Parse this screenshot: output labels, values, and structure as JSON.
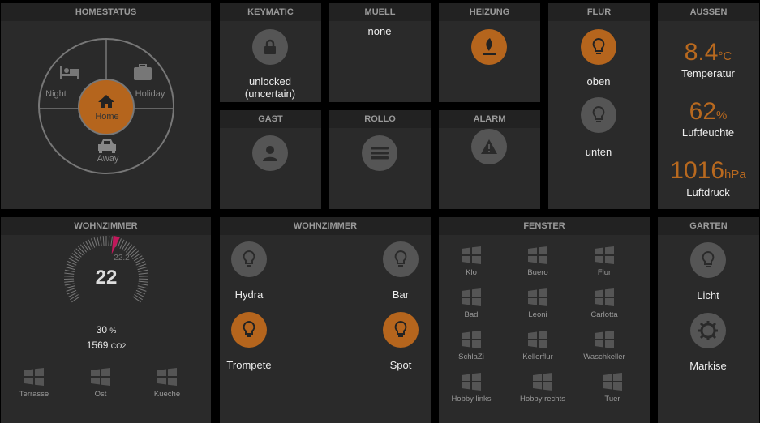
{
  "colors": {
    "accent": "#b5651d",
    "gauge_needle": "#c2185b",
    "icon_off": "#555555"
  },
  "homestatus": {
    "title": "HOMESTATUS",
    "modes": {
      "night": "Night",
      "holiday": "Holiday",
      "home": "Home",
      "away": "Away"
    },
    "active": "Home"
  },
  "keymatic": {
    "title": "KEYMATIC",
    "status_line1": "unlocked",
    "status_line2": "(uncertain)",
    "icon": "lock-icon"
  },
  "muell": {
    "title": "MUELL",
    "value": "none"
  },
  "heizung": {
    "title": "HEIZUNG",
    "icon": "flame-icon",
    "active": true
  },
  "flur": {
    "title": "FLUR",
    "lights": [
      {
        "label": "oben",
        "on": true
      },
      {
        "label": "unten",
        "on": false
      }
    ]
  },
  "aussen": {
    "title": "AUSSEN",
    "temp": {
      "value": "8.4",
      "unit": "°C",
      "label": "Temperatur"
    },
    "humidity": {
      "value": "62",
      "unit": "%",
      "label": "Luftfeuchte"
    },
    "pressure": {
      "value": "1016",
      "unit": "hPa",
      "label": "Luftdruck"
    }
  },
  "gast": {
    "title": "GAST",
    "icon": "user-icon"
  },
  "rollo": {
    "title": "ROLLO",
    "icon": "menu-icon"
  },
  "alarm": {
    "title": "ALARM",
    "icon": "warning-icon"
  },
  "wohnzimmer_climate": {
    "title": "WOHNZIMMER",
    "temp": "22",
    "setpoint": "22.2",
    "humidity": "30",
    "humidity_unit": "%",
    "co2": "1569",
    "co2_unit": "CO2",
    "windows": [
      "Terrasse",
      "Ost",
      "Kueche"
    ]
  },
  "wohnzimmer_lights": {
    "title": "WOHNZIMMER",
    "lights": [
      {
        "label": "Hydra",
        "on": false
      },
      {
        "label": "Bar",
        "on": false
      },
      {
        "label": "Trompete",
        "on": true
      },
      {
        "label": "Spot",
        "on": true
      }
    ]
  },
  "fenster": {
    "title": "FENSTER",
    "windows": [
      "Klo",
      "Buero",
      "Flur",
      "Bad",
      "Leoni",
      "Carlotta",
      "SchlaZi",
      "Kellerflur",
      "Waschkeller",
      "Hobby links",
      "Hobby rechts",
      "Tuer"
    ]
  },
  "garten": {
    "title": "GARTEN",
    "items": [
      {
        "label": "Licht",
        "icon": "bulb-icon"
      },
      {
        "label": "Markise",
        "icon": "sun-icon"
      }
    ]
  }
}
